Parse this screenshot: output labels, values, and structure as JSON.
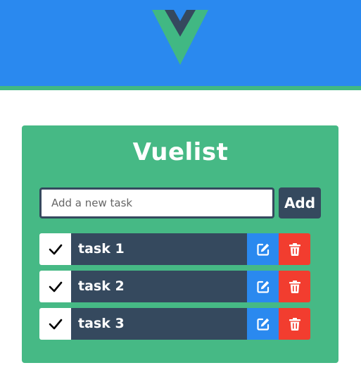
{
  "colors": {
    "header_blue": "#2a89ef",
    "vue_green": "#41b883",
    "card_green": "#46b985",
    "dark_slate": "#35495e",
    "edit_blue": "#2a89ef",
    "delete_red": "#f23d2f"
  },
  "header": {
    "logo_icon": "vue-logo-icon"
  },
  "app": {
    "title": "Vuelist",
    "input_placeholder": "Add a new task",
    "input_value": "",
    "add_label": "Add"
  },
  "tasks": [
    {
      "label": "task 1",
      "done_icon": "check-icon",
      "edit_icon": "edit-icon",
      "delete_icon": "trash-icon"
    },
    {
      "label": "task 2",
      "done_icon": "check-icon",
      "edit_icon": "edit-icon",
      "delete_icon": "trash-icon"
    },
    {
      "label": "task 3",
      "done_icon": "check-icon",
      "edit_icon": "edit-icon",
      "delete_icon": "trash-icon"
    }
  ]
}
